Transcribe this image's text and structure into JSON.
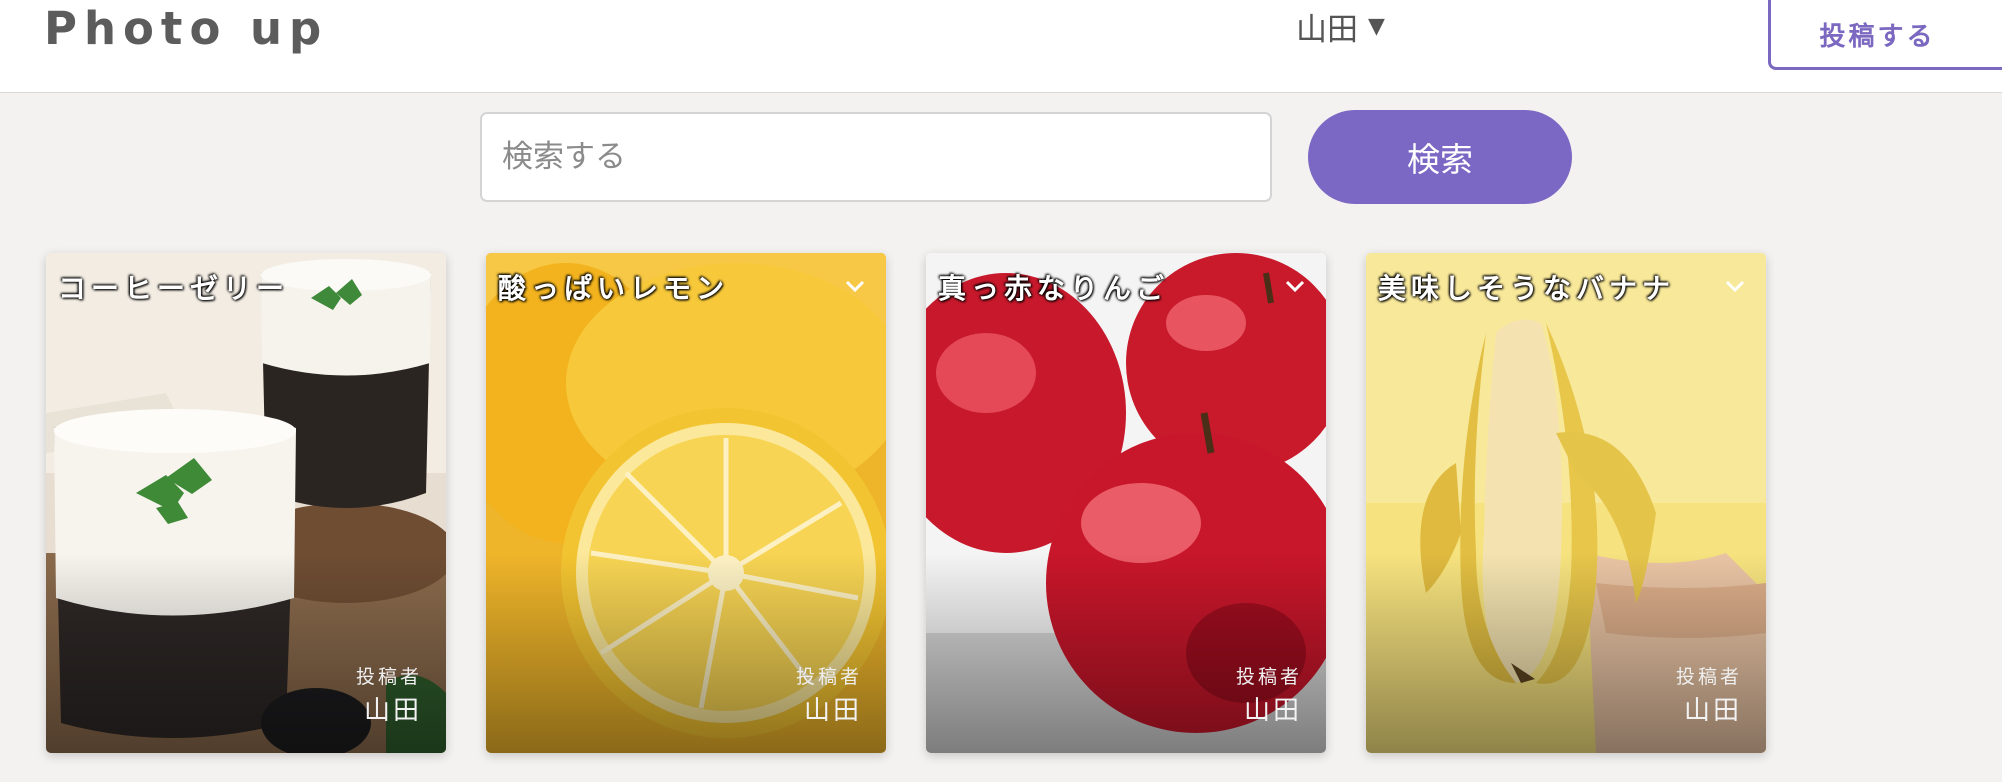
{
  "header": {
    "logo": "Photo up",
    "user_name": "山田",
    "caret": "▼",
    "post_button": "投稿する"
  },
  "search": {
    "placeholder": "検索する",
    "button_label": "検索"
  },
  "colors": {
    "accent": "#7b68c4",
    "header_bg": "#ffffff",
    "page_bg": "#f3f2f0"
  },
  "cards": [
    {
      "title": "コーヒーゼリー",
      "author_label": "投稿者",
      "author": "山田",
      "image": "coffee-jelly-photo"
    },
    {
      "title": "酸っぱいレモン",
      "author_label": "投稿者",
      "author": "山田",
      "image": "lemon-photo"
    },
    {
      "title": "真っ赤なりんご",
      "author_label": "投稿者",
      "author": "山田",
      "image": "apple-photo"
    },
    {
      "title": "美味しそうなバナナ",
      "author_label": "投稿者",
      "author": "山田",
      "image": "banana-photo"
    }
  ]
}
